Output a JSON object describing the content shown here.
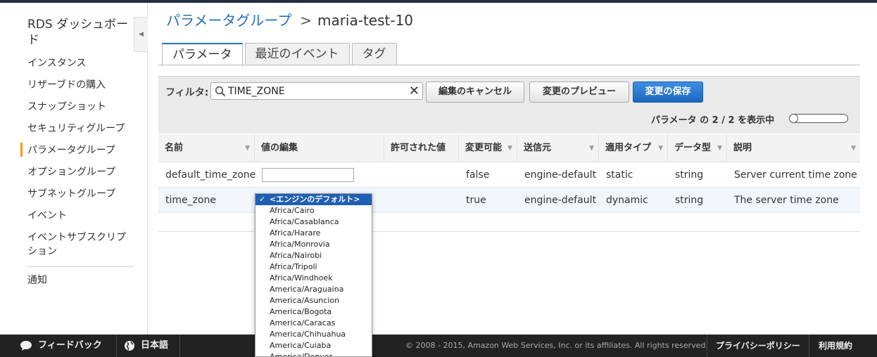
{
  "sidebar": {
    "title": "RDS ダッシュボード",
    "items": [
      {
        "label": "インスタンス"
      },
      {
        "label": "リザーブドの購入"
      },
      {
        "label": "スナップショット"
      },
      {
        "label": "セキュリティグループ"
      },
      {
        "label": "パラメータグループ"
      },
      {
        "label": "オプショングループ"
      },
      {
        "label": "サブネットグループ"
      },
      {
        "label": "イベント"
      },
      {
        "label": "イベントサブスクリプション"
      }
    ],
    "extra_item": "通知"
  },
  "breadcrumb": {
    "parent": "パラメータグループ",
    "separator": ">",
    "current": "maria-test-10"
  },
  "tabs": [
    {
      "label": "パラメータ"
    },
    {
      "label": "最近のイベント"
    },
    {
      "label": "タグ"
    }
  ],
  "toolbar": {
    "filter_label": "フィルタ:",
    "filter_value": "TIME_ZONE",
    "clear_glyph": "✕",
    "cancel_edit": "編集のキャンセル",
    "preview_changes": "変更のプレビュー",
    "save_changes": "変更の保存",
    "count_text": "パラメータ の 2 / 2 を表示中"
  },
  "table": {
    "headers": [
      "名前",
      "値の編集",
      "許可された値",
      "変更可能",
      "送信元",
      "適用タイプ",
      "データ型",
      "説明"
    ],
    "rows": [
      {
        "name": "default_time_zone",
        "value": "",
        "allowed": "",
        "modifiable": "false",
        "source": "engine-default",
        "apply_type": "static",
        "data_type": "string",
        "description": "Server current time zone"
      },
      {
        "name": "time_zone",
        "value": "<エンジンのデフォルト>",
        "allowed": "",
        "modifiable": "true",
        "source": "engine-default",
        "apply_type": "dynamic",
        "data_type": "string",
        "description": "The server time zone"
      }
    ]
  },
  "dropdown": {
    "selected": "<エンジンのデフォルト>",
    "options": [
      "Africa/Cairo",
      "Africa/Casablanca",
      "Africa/Harare",
      "Africa/Monrovia",
      "Africa/Nairobi",
      "Africa/Tripoli",
      "Africa/Windhoek",
      "America/Araguaina",
      "America/Asuncion",
      "America/Bogota",
      "America/Caracas",
      "America/Chihuahua",
      "America/Cuiaba",
      "America/Denver"
    ]
  },
  "footer": {
    "feedback": "フィードバック",
    "language": "日本語",
    "copyright": "© 2008 - 2015, Amazon Web Services, Inc. or its affiliates. All rights reserved.",
    "privacy": "プライバシーポリシー",
    "terms": "利用規約"
  },
  "colors": {
    "link": "#2a6fb5",
    "primary_button": "#1e66c1",
    "active_marker": "#ff9900",
    "footer_bg": "#222222"
  }
}
